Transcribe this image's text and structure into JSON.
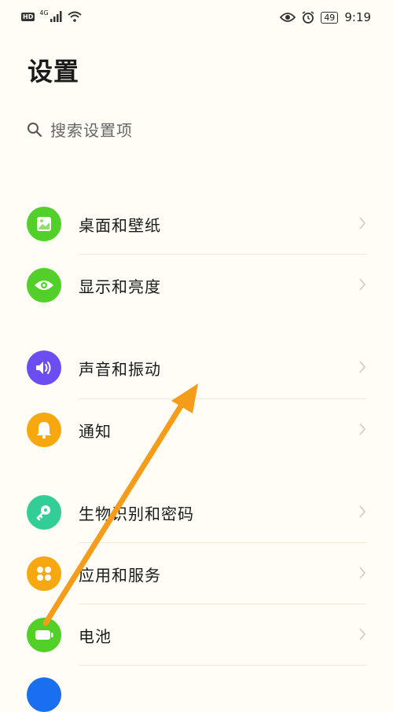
{
  "status_bar": {
    "hd": "HD",
    "network": "4G",
    "battery": "49",
    "time": "9:19"
  },
  "page_title": "设置",
  "search": {
    "placeholder": "搜索设置项"
  },
  "items": [
    {
      "label": "桌面和壁纸",
      "icon": "wallpaper-icon",
      "color": "#52cf29"
    },
    {
      "label": "显示和亮度",
      "icon": "eye-icon",
      "color": "#52cf29"
    },
    {
      "label": "声音和振动",
      "icon": "speaker-icon",
      "color": "#6a4ef2"
    },
    {
      "label": "通知",
      "icon": "bell-icon",
      "color": "#f7a80e"
    },
    {
      "label": "生物识别和密码",
      "icon": "key-icon",
      "color": "#33cd98"
    },
    {
      "label": "应用和服务",
      "icon": "apps-icon",
      "color": "#f7a80e"
    },
    {
      "label": "电池",
      "icon": "battery-icon",
      "color": "#52cf29"
    }
  ],
  "colors": {
    "background": "#fffdf5",
    "annotation_arrow": "#f59c1a"
  }
}
